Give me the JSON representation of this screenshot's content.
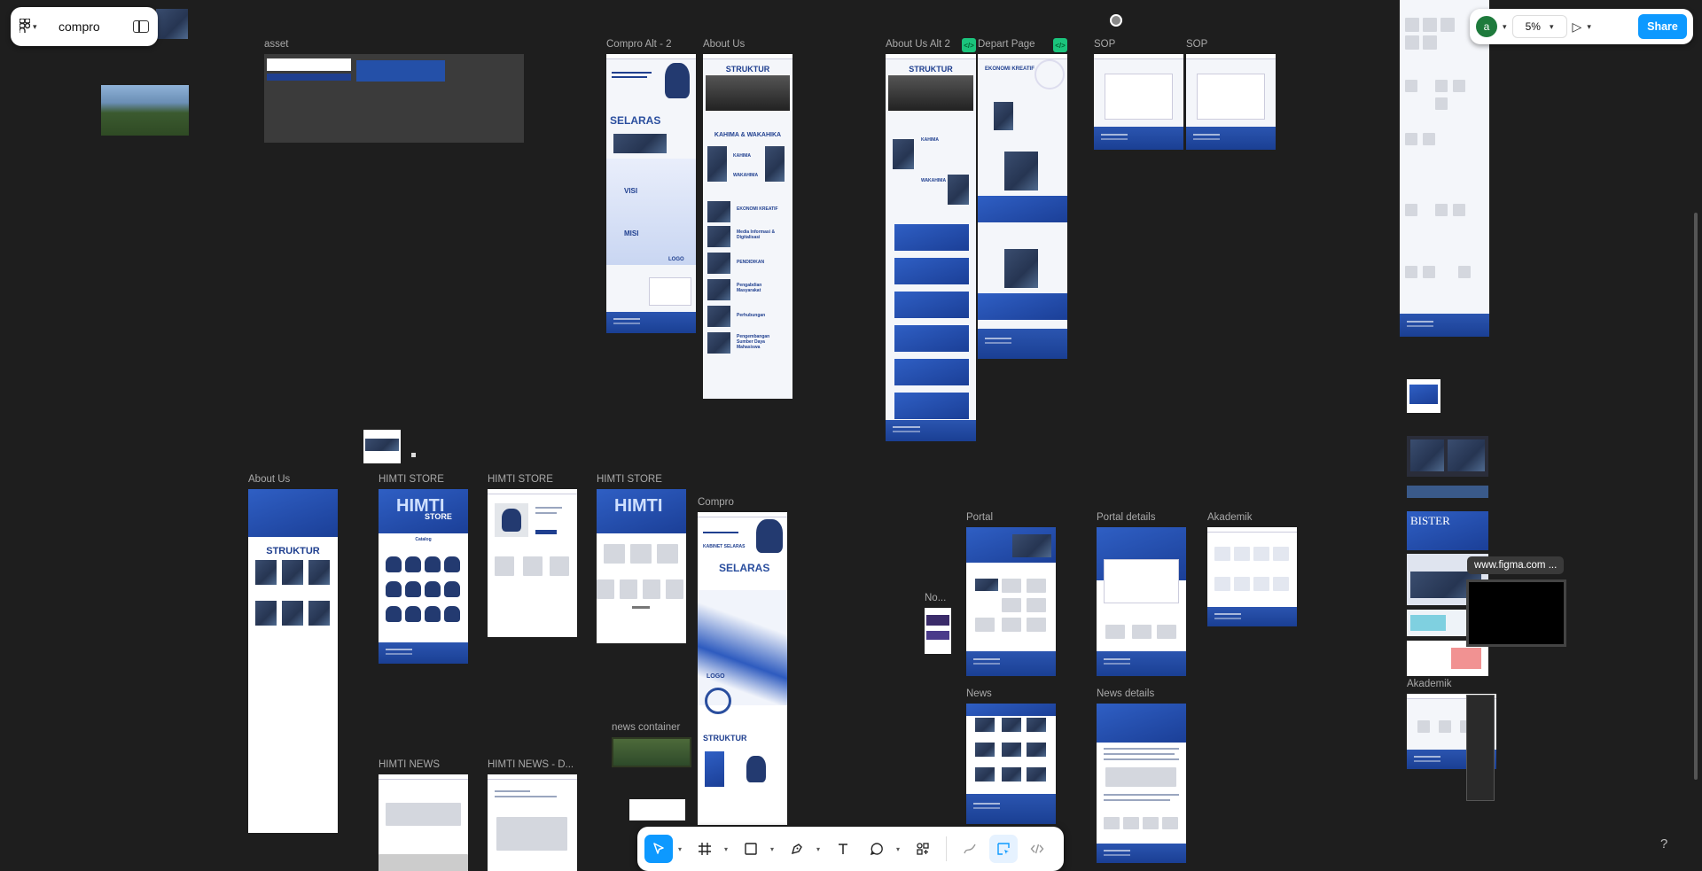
{
  "file": {
    "name": "compro"
  },
  "user": {
    "initial": "a"
  },
  "zoom": "5%",
  "share_label": "Share",
  "tooltip": "www.figma.com ...",
  "help": "?",
  "frames": {
    "asset": "asset",
    "compro_alt2": "Compro Alt - 2",
    "about_us_top": "About Us",
    "about_us_alt2": "About Us Alt 2",
    "depart_page": "Depart Page",
    "sop1": "SOP",
    "sop2": "SOP",
    "about_us_bottom": "About Us",
    "himti_store1": "HIMTI STORE",
    "himti_store2": "HIMTI STORE",
    "himti_store3": "HIMTI STORE",
    "compro": "Compro",
    "news_container": "news container",
    "himti_news": "HIMTI NEWS",
    "himti_news_d": "HIMTI NEWS - D...",
    "portal": "Portal",
    "portal_details": "Portal details",
    "akademik_mid": "Akademik",
    "no_label": "No...",
    "news": "News",
    "news_details": "News details",
    "akademik_right": "Akademik"
  },
  "content": {
    "struktur": "STRUKTUR",
    "selaras": "SELARAS",
    "visi": "VISI",
    "misi": "MISI",
    "logo": "LOGO",
    "kahima_wakahika": "KAHIMA & WAKAHIKA",
    "kahima": "KAHIMA",
    "wakahima": "WAKAHIMA",
    "ekonomi_kreatif": "EKONOMI KREATIF",
    "media_informasi": "Media Informasi & Digitalisasi",
    "pendidikan": "PENDIDIKAN",
    "pengabdian": "Pengabdian Masyarakat",
    "perhubungan": "Perhubungan",
    "pengembangan": "Pengembangan Sumber Daya Mahasiswa",
    "himti": "HIMTI",
    "store": "STORE",
    "catalog": "Catalog",
    "kabinet_selaras": "KABINET SELARAS",
    "bister": "BISTER"
  }
}
